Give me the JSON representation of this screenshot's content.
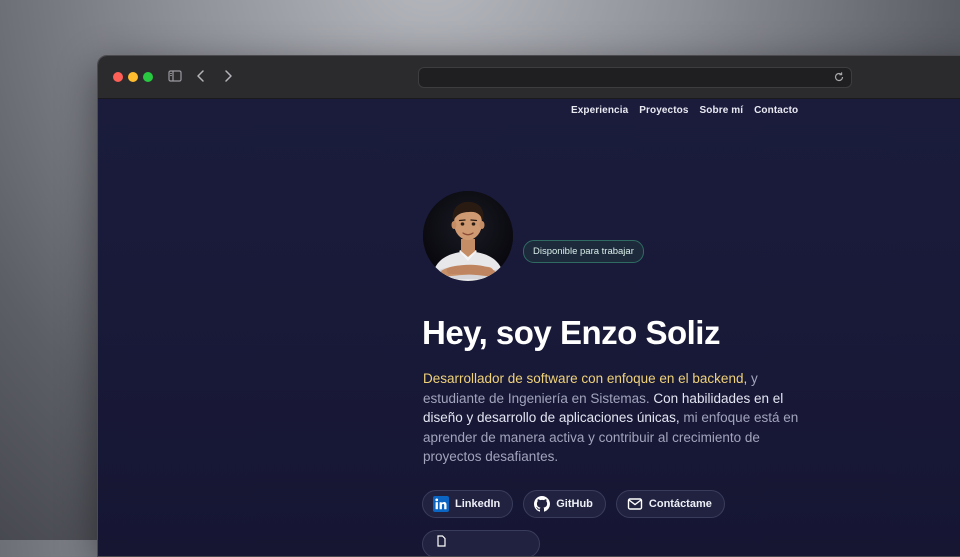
{
  "browser": {
    "address_value": "",
    "icons": [
      "sidebar-icon",
      "back-icon",
      "forward-icon",
      "reload-icon"
    ]
  },
  "nav": {
    "items": [
      "Experiencia",
      "Proyectos",
      "Sobre mí",
      "Contacto"
    ]
  },
  "hero": {
    "badge": "Disponible para trabajar",
    "title": "Hey, soy Enzo Soliz",
    "intro": {
      "highlight": "Desarrollador de software con enfoque en el backend,",
      "part1": " y estudiante de Ingeniería en Sistemas. ",
      "strong": "Con habilidades en el diseño y desarrollo de aplicaciones únicas,",
      "part2": " mi enfoque está en aprender de manera activa y contribuir al crecimiento de proyectos desafiantes."
    },
    "buttons": {
      "linkedin": "LinkedIn",
      "github": "GitHub",
      "contact": "Contáctame"
    }
  },
  "colors": {
    "background": "#181937",
    "highlight": "#f0d27a",
    "badge_border": "#2f6b62",
    "linkedin": "#0a66c2"
  }
}
